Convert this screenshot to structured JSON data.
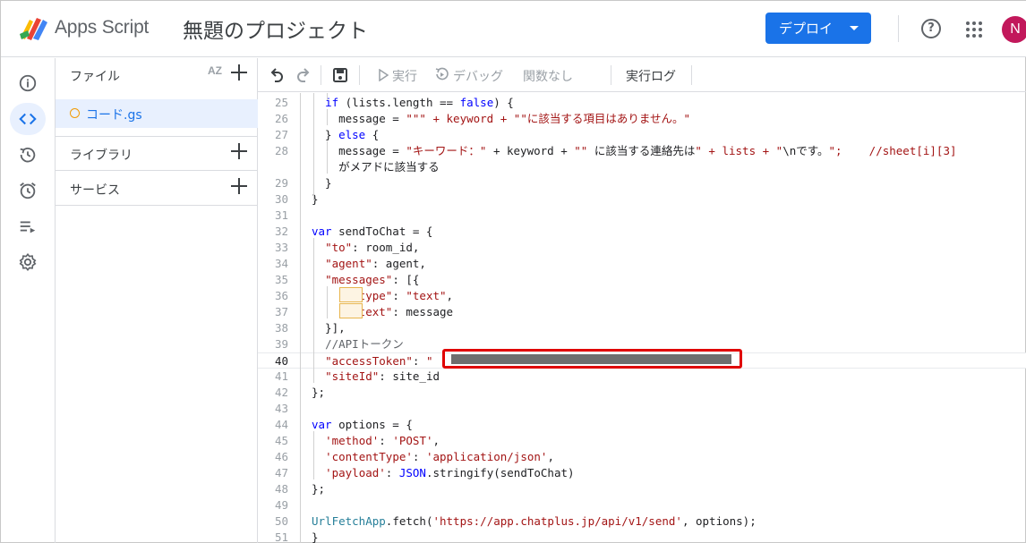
{
  "header": {
    "app_name": "Apps Script",
    "project_title": "無題のプロジェクト",
    "deploy_label": "デプロイ",
    "help_glyph": "?",
    "avatar_initial": "N"
  },
  "files_panel": {
    "files_label": "ファイル",
    "sort_label": "AZ",
    "file_name": "コード.gs",
    "libraries_label": "ライブラリ",
    "services_label": "サービス"
  },
  "toolbar": {
    "run_label": "実行",
    "debug_label": "デバッグ",
    "function_label": "関数なし",
    "log_label": "実行ログ"
  },
  "colors": {
    "accent": "#1a73e8",
    "avatar": "#c2185b",
    "highlight_box": "#e00000"
  },
  "editor": {
    "current_line": 40,
    "lines": [
      {
        "n": "25",
        "t": "  if (lists.length == false) {"
      },
      {
        "n": "26",
        "t": "    message = \"\"\" + keyword + \"\"に該当する項目はありません。\""
      },
      {
        "n": "27",
        "t": "  } else {"
      },
      {
        "n": "28",
        "t": "    message = \"キーワード：\" + keyword + \"\" に該当する連絡先は\" + lists + \"\\nです。\";    //sheet[i][3]"
      },
      {
        "n": "",
        "t": "    がメアドに該当する"
      },
      {
        "n": "29",
        "t": "  }"
      },
      {
        "n": "30",
        "t": "}"
      },
      {
        "n": "31",
        "t": ""
      },
      {
        "n": "32",
        "t": "var sendToChat = {"
      },
      {
        "n": "33",
        "t": "  \"to\": room_id,"
      },
      {
        "n": "34",
        "t": "  \"agent\": agent,"
      },
      {
        "n": "35",
        "t": "  \"messages\": [{"
      },
      {
        "n": "36",
        "t": "      \"type\": \"text\","
      },
      {
        "n": "37",
        "t": "      \"text\": message"
      },
      {
        "n": "38",
        "t": "  }],"
      },
      {
        "n": "39",
        "t": "  //APIトークン"
      },
      {
        "n": "40",
        "t": "  \"accessToken\": \""
      },
      {
        "n": "41",
        "t": "  \"siteId\": site_id"
      },
      {
        "n": "42",
        "t": "};"
      },
      {
        "n": "43",
        "t": ""
      },
      {
        "n": "44",
        "t": "var options = {"
      },
      {
        "n": "45",
        "t": "  'method': 'POST',"
      },
      {
        "n": "46",
        "t": "  'contentType': 'application/json',"
      },
      {
        "n": "47",
        "t": "  'payload': JSON.stringify(sendToChat)"
      },
      {
        "n": "48",
        "t": "};"
      },
      {
        "n": "49",
        "t": ""
      },
      {
        "n": "50",
        "t": "UrlFetchApp.fetch('https://app.chatplus.jp/api/v1/send', options);"
      },
      {
        "n": "51",
        "t": "}"
      }
    ]
  }
}
